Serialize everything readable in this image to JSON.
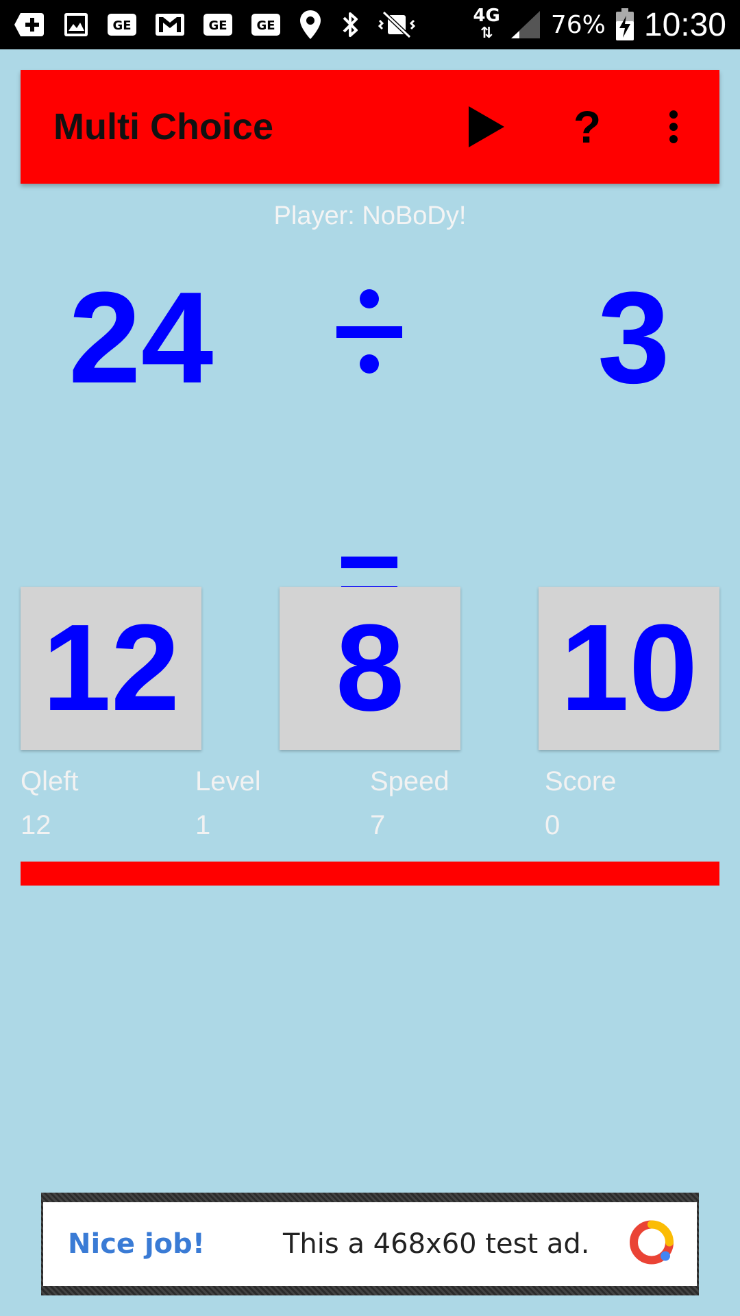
{
  "status_bar": {
    "battery_percent": "76%",
    "time": "10:30",
    "network": "4G",
    "icons": [
      "add-box-icon",
      "image-icon",
      "ge-icon",
      "gmail-icon",
      "ge-icon",
      "ge-icon",
      "location-icon",
      "bluetooth-icon",
      "vibrate-icon",
      "signal-icon",
      "battery-charging-icon"
    ]
  },
  "app_bar": {
    "title": "Multi Choice",
    "play_icon": "play-icon",
    "help_label": "?",
    "more_icon": "more-vert-icon",
    "background_color": "#ff0000"
  },
  "player": "Player: NoBoDy!",
  "equation": {
    "left": "24",
    "operator": "divide",
    "right": "3",
    "equals": "equals"
  },
  "answers": [
    "12",
    "8",
    "10"
  ],
  "stats": {
    "qleft": {
      "label": "Qleft",
      "value": "12"
    },
    "level": {
      "label": "Level",
      "value": "1"
    },
    "speed": {
      "label": "Speed",
      "value": "7"
    },
    "score": {
      "label": "Score",
      "value": "0"
    }
  },
  "timer_progress": 1.0,
  "ad": {
    "tagline": "Nice job!",
    "text": "This a 468x60 test ad."
  },
  "colors": {
    "background": "#add8e6",
    "accent": "#ff0000",
    "number": "#0000ff",
    "answer_box": "#d3d3d3"
  }
}
